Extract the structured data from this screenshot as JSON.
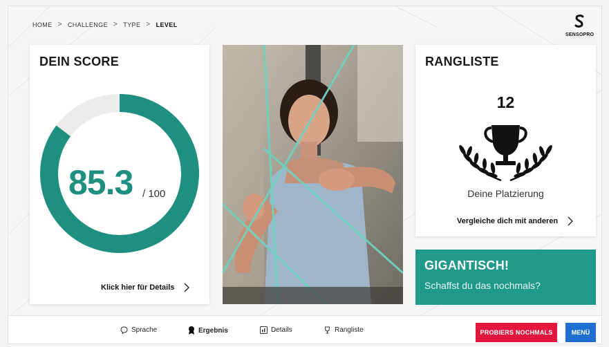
{
  "breadcrumb": {
    "items": [
      "HOME",
      "CHALLENGE",
      "TYPE"
    ],
    "current": "LEVEL",
    "separator": ">"
  },
  "logo": {
    "text": "SENSOPRO",
    "icon": "sensopro-s-icon"
  },
  "score_card": {
    "title": "DEIN SCORE",
    "score": "85.3",
    "max": "/ 100",
    "progress_fraction": 0.853,
    "detail_link": "Klick hier für Details"
  },
  "photo": {
    "icon": "athlete-photo"
  },
  "ranking": {
    "title": "RANGLISTE",
    "place": "12",
    "caption": "Deine Platzierung",
    "compare_link": "Vergleiche dich mit anderen",
    "icon": "trophy-laurel-icon"
  },
  "promo": {
    "title": "GIGANTISCH!",
    "subtitle": "Schaffst du das nochmals?"
  },
  "bottom_nav": {
    "items": [
      {
        "label": "Sprache",
        "icon": "speech-bubble-icon"
      },
      {
        "label": "Ergebnis",
        "icon": "medal-icon"
      },
      {
        "label": "Details",
        "icon": "details-icon"
      },
      {
        "label": "Rangliste",
        "icon": "trophy-icon"
      }
    ],
    "retry_button": "PROBIERS NOCHMALS",
    "menu_button": "MENÜ"
  },
  "colors": {
    "accent_teal": "#1f9a8a",
    "retry_red": "#e3173e",
    "menu_blue": "#1f6fd0"
  }
}
